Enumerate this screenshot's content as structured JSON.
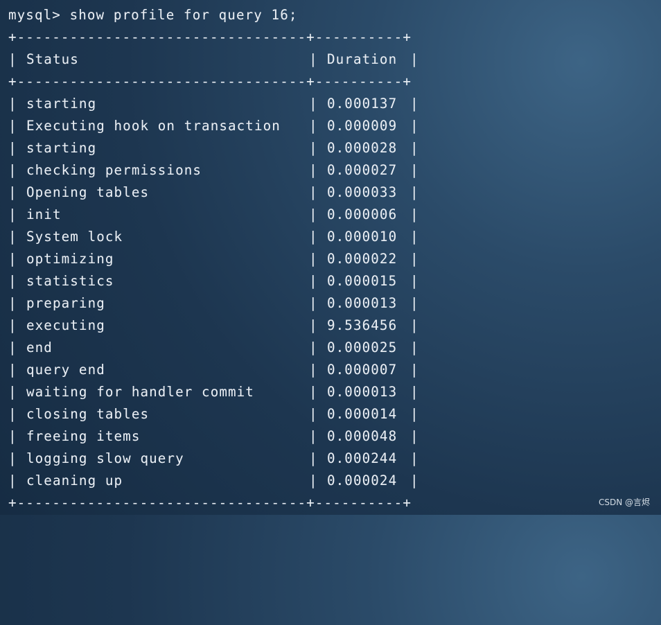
{
  "terminal": {
    "prompt": "mysql> show profile for query 16;",
    "border": "+---------------------------------+----------+",
    "headers": {
      "status": "Status",
      "duration": "Duration"
    },
    "rows": [
      {
        "status": "starting",
        "duration": "0.000137"
      },
      {
        "status": "Executing hook on transaction",
        "duration": "0.000009"
      },
      {
        "status": "starting",
        "duration": "0.000028"
      },
      {
        "status": "checking permissions",
        "duration": "0.000027"
      },
      {
        "status": "Opening tables",
        "duration": "0.000033"
      },
      {
        "status": "init",
        "duration": "0.000006"
      },
      {
        "status": "System lock",
        "duration": "0.000010"
      },
      {
        "status": "optimizing",
        "duration": "0.000022"
      },
      {
        "status": "statistics",
        "duration": "0.000015"
      },
      {
        "status": "preparing",
        "duration": "0.000013"
      },
      {
        "status": "executing",
        "duration": "9.536456"
      },
      {
        "status": "end",
        "duration": "0.000025"
      },
      {
        "status": "query end",
        "duration": "0.000007"
      },
      {
        "status": "waiting for handler commit",
        "duration": "0.000013"
      },
      {
        "status": "closing tables",
        "duration": "0.000014"
      },
      {
        "status": "freeing items",
        "duration": "0.000048"
      },
      {
        "status": "logging slow query",
        "duration": "0.000244"
      },
      {
        "status": "cleaning up",
        "duration": "0.000024"
      }
    ]
  },
  "watermark": "CSDN @言烬"
}
